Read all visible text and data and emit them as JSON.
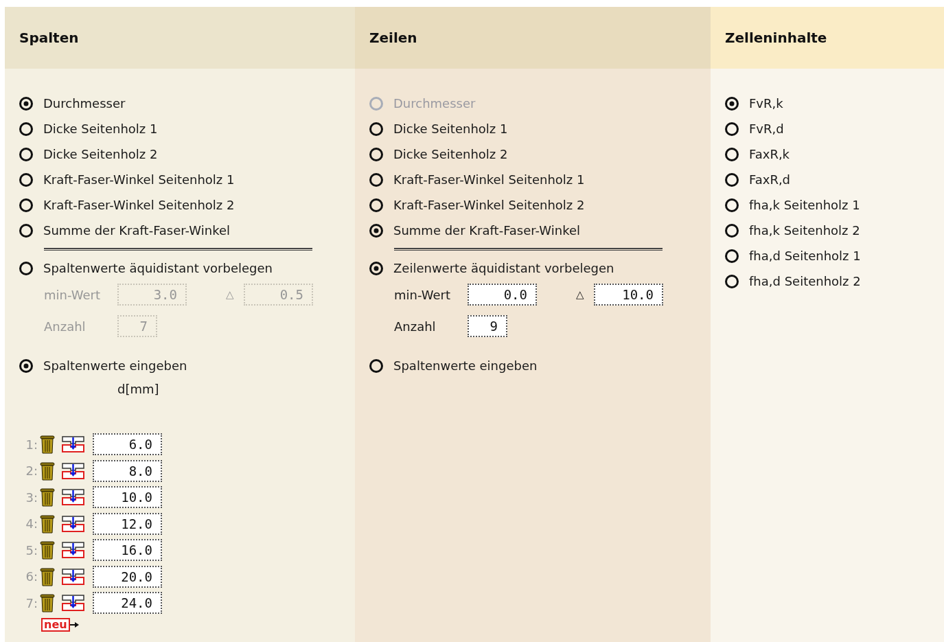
{
  "columns": [
    {
      "title": "Spalten",
      "options": [
        {
          "label": "Durchmesser",
          "selected": true,
          "disabled": false
        },
        {
          "label": "Dicke Seitenholz 1",
          "selected": false,
          "disabled": false
        },
        {
          "label": "Dicke Seitenholz 2",
          "selected": false,
          "disabled": false
        },
        {
          "label": "Kraft-Faser-Winkel Seitenholz 1",
          "selected": false,
          "disabled": false
        },
        {
          "label": "Kraft-Faser-Winkel Seitenholz 2",
          "selected": false,
          "disabled": false
        },
        {
          "label": "Summe der Kraft-Faser-Winkel",
          "selected": false,
          "disabled": false
        }
      ],
      "equidistant": {
        "label": "Spaltenwerte äquidistant vorbelegen",
        "selected": false,
        "disabled": true,
        "min_label": "min-Wert",
        "min_value": "3.0",
        "delta_label": "△",
        "delta_value": "0.5",
        "count_label": "Anzahl",
        "count_value": "7"
      },
      "manual": {
        "label": "Spaltenwerte eingeben",
        "selected": true
      },
      "unit_label": "d[mm]",
      "entries": [
        {
          "index": "1:",
          "value": "6.0"
        },
        {
          "index": "2:",
          "value": "8.0"
        },
        {
          "index": "3:",
          "value": "10.0"
        },
        {
          "index": "4:",
          "value": "12.0"
        },
        {
          "index": "5:",
          "value": "16.0"
        },
        {
          "index": "6:",
          "value": "20.0"
        },
        {
          "index": "7:",
          "value": "24.0"
        }
      ],
      "new_button": "neu"
    },
    {
      "title": "Zeilen",
      "options": [
        {
          "label": "Durchmesser",
          "selected": false,
          "disabled": true
        },
        {
          "label": "Dicke Seitenholz 1",
          "selected": false,
          "disabled": false
        },
        {
          "label": "Dicke Seitenholz 2",
          "selected": false,
          "disabled": false
        },
        {
          "label": "Kraft-Faser-Winkel Seitenholz 1",
          "selected": false,
          "disabled": false
        },
        {
          "label": "Kraft-Faser-Winkel Seitenholz 2",
          "selected": false,
          "disabled": false
        },
        {
          "label": "Summe der Kraft-Faser-Winkel",
          "selected": true,
          "disabled": false
        }
      ],
      "equidistant": {
        "label": "Zeilenwerte äquidistant vorbelegen",
        "selected": true,
        "disabled": false,
        "min_label": "min-Wert",
        "min_value": "0.0",
        "delta_label": "△",
        "delta_value": "10.0",
        "count_label": "Anzahl",
        "count_value": "9"
      },
      "manual": {
        "label": "Spaltenwerte eingeben",
        "selected": false
      }
    },
    {
      "title": "Zelleninhalte",
      "options": [
        {
          "label": "FvR,k",
          "selected": true,
          "disabled": false
        },
        {
          "label": "FvR,d",
          "selected": false,
          "disabled": false
        },
        {
          "label": "FaxR,k",
          "selected": false,
          "disabled": false
        },
        {
          "label": "FaxR,d",
          "selected": false,
          "disabled": false
        },
        {
          "label": "fha,k Seitenholz 1",
          "selected": false,
          "disabled": false
        },
        {
          "label": "fha,k Seitenholz 2",
          "selected": false,
          "disabled": false
        },
        {
          "label": "fha,d Seitenholz 1",
          "selected": false,
          "disabled": false
        },
        {
          "label": "fha,d Seitenholz 2",
          "selected": false,
          "disabled": false
        }
      ]
    }
  ]
}
